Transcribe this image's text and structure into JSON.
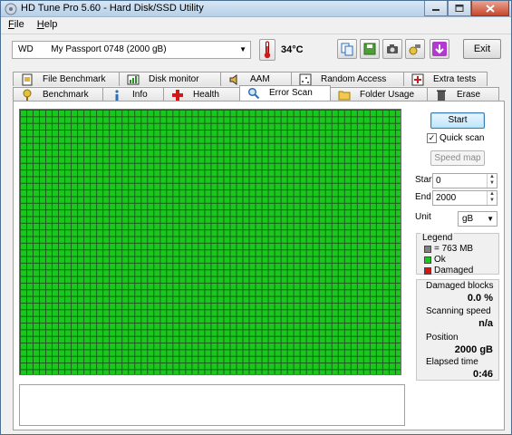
{
  "window": {
    "title": "HD Tune Pro 5.60 - Hard Disk/SSD Utility"
  },
  "menu": [
    {
      "label": "File",
      "accel": "F",
      "rest": "ile"
    },
    {
      "label": "Help",
      "accel": "H",
      "rest": "elp"
    }
  ],
  "toolbar": {
    "drive_brand": "WD",
    "drive_name": "My Passport 0748 (2000 gB)",
    "temperature": "34°C",
    "icons": [
      "copy-icon",
      "save-icon",
      "screenshot-icon",
      "options-icon",
      "download-icon"
    ],
    "exit_label": "Exit"
  },
  "tabs_top": [
    {
      "label": "File Benchmark",
      "icon": "file-benchmark-icon"
    },
    {
      "label": "Disk monitor",
      "icon": "disk-monitor-icon"
    },
    {
      "label": "AAM",
      "icon": "speaker-icon"
    },
    {
      "label": "Random Access",
      "icon": "random-access-icon"
    },
    {
      "label": "Extra tests",
      "icon": "extra-tests-icon"
    }
  ],
  "tabs_bottom": [
    {
      "label": "Benchmark",
      "icon": "benchmark-icon"
    },
    {
      "label": "Info",
      "icon": "info-icon"
    },
    {
      "label": "Health",
      "icon": "health-cross-icon"
    },
    {
      "label": "Error Scan",
      "icon": "magnifier-icon",
      "active": true
    },
    {
      "label": "Folder Usage",
      "icon": "folder-icon"
    },
    {
      "label": "Erase",
      "icon": "trash-icon"
    }
  ],
  "scan": {
    "start_label": "Start",
    "quick_scan_label": "Quick scan",
    "quick_scan_checked": "✓",
    "speed_map_label": "Speed map",
    "start_field_label": "Start",
    "start_value": "0",
    "end_field_label": "End",
    "end_value": "2000",
    "unit_label": "Unit",
    "unit_value": "gB"
  },
  "legend": {
    "title": "Legend",
    "items": [
      {
        "label": "= 763 MB",
        "color": "#808080"
      },
      {
        "label": "Ok",
        "color": "#19c81c"
      },
      {
        "label": "Damaged",
        "color": "#d01818"
      }
    ]
  },
  "stats": {
    "damaged_blocks_label": "Damaged blocks",
    "damaged_blocks_value": "0.0 %",
    "scanning_speed_label": "Scanning speed",
    "scanning_speed_value": "n/a",
    "position_label": "Position",
    "position_value": "2000 gB",
    "elapsed_label": "Elapsed time",
    "elapsed_value": "0:46"
  },
  "colors": {
    "ok_block": "#19c81c",
    "grid_line": "#1a5a1a",
    "accent": "#3c7fb1"
  }
}
